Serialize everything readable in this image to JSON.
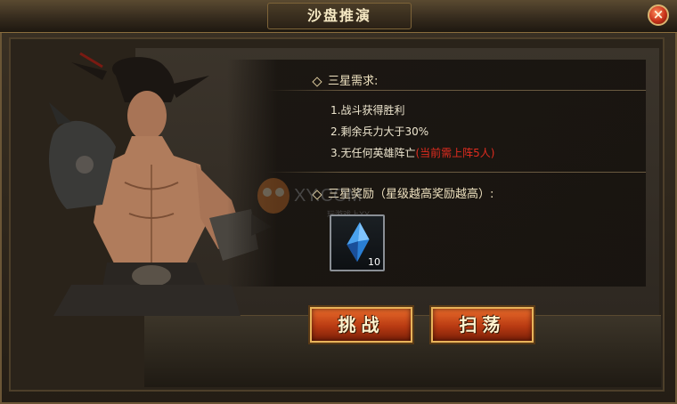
{
  "window": {
    "title": "沙盘推演",
    "close_glyph": "×"
  },
  "requirements": {
    "heading": "三星需求:",
    "items": [
      "1.战斗获得胜利",
      "2.剩余兵力大于30%",
      "3.无任何英雄阵亡"
    ],
    "item3_note": "(当前需上阵5人)"
  },
  "rewards": {
    "heading": "三星奖励（星级越高奖励越高）:",
    "items": [
      {
        "icon": "blue-crystal-icon",
        "count": "10"
      }
    ]
  },
  "buttons": {
    "challenge": "挑战",
    "sweep": "扫荡"
  },
  "watermark": {
    "text": "XY.COM",
    "subtext": "玩游戏上XY"
  },
  "colors": {
    "highlight_red": "#e02c1f",
    "button_orange": "#d2521c",
    "title_text": "#f6e9c4"
  }
}
